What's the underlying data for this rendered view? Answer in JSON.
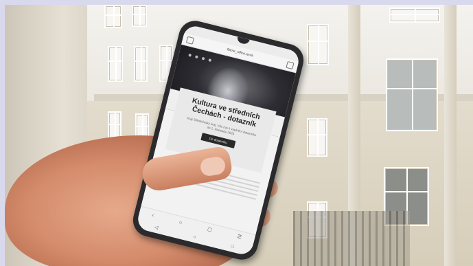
{
  "phone": {
    "browser_title": "flame_office.work",
    "status_left": "",
    "status_right": "",
    "card": {
      "title_line1": "Kultura ve středních",
      "title_line2": "Čechách - dotazník",
      "text": "Kraj Středočeský kraj, Vás zve k vyplnění dotazníku do 1. listopadu 2023",
      "button": "Do dotazníku"
    },
    "nav": {
      "back_icon": "chevron-left-icon",
      "home_icon": "home-icon",
      "tabs_icon": "tabs-icon",
      "menu_icon": "menu-icon"
    }
  },
  "colors": {
    "phone_body": "#2b2b2d",
    "card_bg": "#e9e9e9",
    "button_bg": "#2a2a2a",
    "skin": "#d48c6c",
    "building": "#e3dccd"
  }
}
